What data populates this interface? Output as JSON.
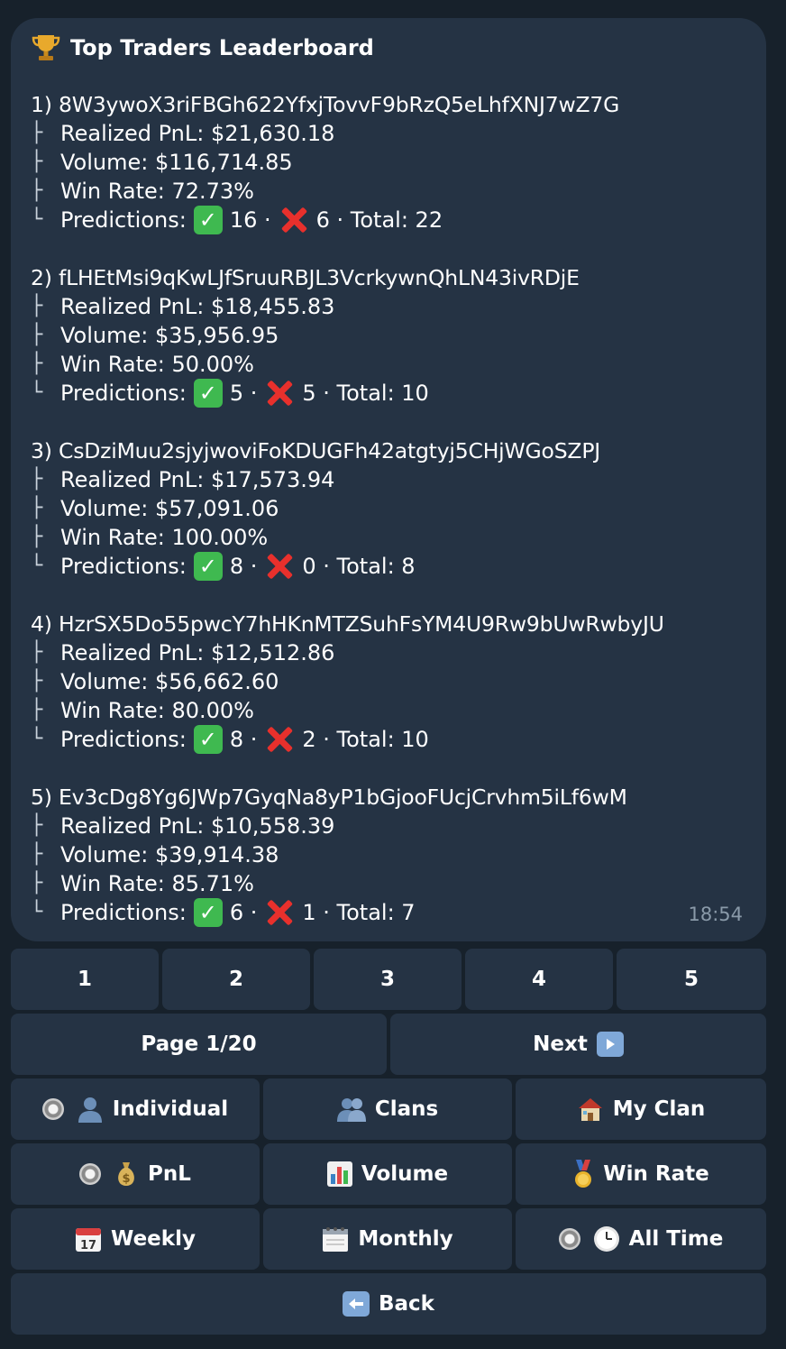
{
  "message": {
    "title": "Top Traders Leaderboard",
    "time": "18:54",
    "entries": [
      {
        "head": "1) 8W3ywoX3riFBGh622YfxjTovvF9bRzQ5eLhfXNJ7wZ7G",
        "pnl": "Realized PnL: $21,630.18",
        "volume": "Volume: $116,714.85",
        "winrate": "Win Rate: 72.73%",
        "pred_label": "Predictions:",
        "wins": "16 ·",
        "losses": "6 · Total: 22"
      },
      {
        "head": "2) fLHEtMsi9qKwLJfSruuRBJL3VcrkywnQhLN43ivRDjE",
        "pnl": "Realized PnL: $18,455.83",
        "volume": "Volume: $35,956.95",
        "winrate": "Win Rate: 50.00%",
        "pred_label": "Predictions:",
        "wins": "5 ·",
        "losses": "5 · Total: 10"
      },
      {
        "head": "3) CsDziMuu2sjyjwoviFoKDUGFh42atgtyj5CHjWGoSZPJ",
        "pnl": "Realized PnL: $17,573.94",
        "volume": "Volume: $57,091.06",
        "winrate": "Win Rate: 100.00%",
        "pred_label": "Predictions:",
        "wins": "8 ·",
        "losses": "0 · Total: 8"
      },
      {
        "head": "4) HzrSX5Do55pwcY7hHKnMTZSuhFsYM4U9Rw9bUwRwbyJU",
        "pnl": "Realized PnL: $12,512.86",
        "volume": "Volume: $56,662.60",
        "winrate": "Win Rate: 80.00%",
        "pred_label": "Predictions:",
        "wins": "8 ·",
        "losses": "2 · Total: 10"
      },
      {
        "head": "5) Ev3cDg8Yg6JWp7GyqNa8yP1bGjooFUcjCrvhm5iLf6wM",
        "pnl": "Realized PnL: $10,558.39",
        "volume": "Volume: $39,914.38",
        "winrate": "Win Rate: 85.71%",
        "pred_label": "Predictions:",
        "wins": "6 ·",
        "losses": "1 · Total: 7"
      }
    ]
  },
  "keyboard": {
    "pages": [
      "1",
      "2",
      "3",
      "4",
      "5"
    ],
    "page_label": "Page 1/20",
    "next_label": "Next",
    "scope": {
      "individual": "Individual",
      "clans": "Clans",
      "my_clan": "My Clan"
    },
    "metric": {
      "pnl": "PnL",
      "volume": "Volume",
      "win_rate": "Win Rate"
    },
    "period": {
      "weekly": "Weekly",
      "monthly": "Monthly",
      "all_time": "All Time"
    },
    "back_label": "Back"
  },
  "icons": {
    "title": "trophy-icon",
    "win": "check-mark-icon",
    "loss": "cross-mark-icon",
    "selected": "radio-button-icon",
    "individual": "person-icon",
    "clans": "people-icon",
    "my_clan": "house-icon",
    "pnl": "money-bag-icon",
    "volume": "bar-chart-icon",
    "win_rate": "medal-icon",
    "weekly": "calendar-icon",
    "monthly": "spiral-calendar-icon",
    "all_time": "clock-icon",
    "next": "play-arrow-icon",
    "back": "back-arrow-icon"
  },
  "colors": {
    "background": "#17212b",
    "bubble": "#253344",
    "win": "#3fb950",
    "loss": "#e8302c"
  }
}
